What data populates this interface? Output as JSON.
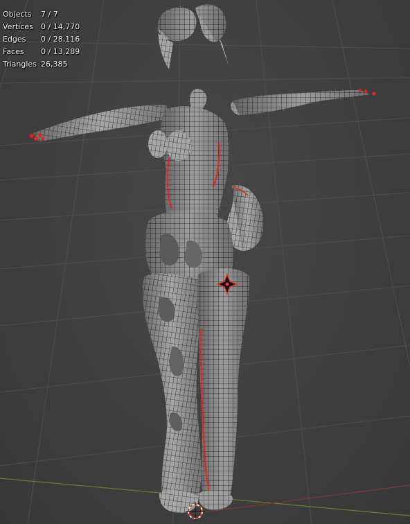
{
  "overlay": {
    "stats": [
      {
        "label": "Objects",
        "value": "7 / 7"
      },
      {
        "label": "Vertices",
        "value": "0 / 14,770"
      },
      {
        "label": "Edges",
        "value": "0 / 28,116"
      },
      {
        "label": "Faces",
        "value": "0 / 13,289"
      },
      {
        "label": "Triangles",
        "value": "26,385"
      }
    ]
  },
  "colors": {
    "background": "#3f3f3f",
    "grid": "#4d4d4d",
    "x_axis": "#8a3a3a",
    "y_axis": "#5f7f2c",
    "mesh_fill": "#9a9a9a",
    "wire": "#2b2b2b",
    "seam": "#e8231c",
    "cursor": "#e03a2a"
  },
  "icons": [
    "3d-cursor-icon",
    "origin-icon"
  ]
}
